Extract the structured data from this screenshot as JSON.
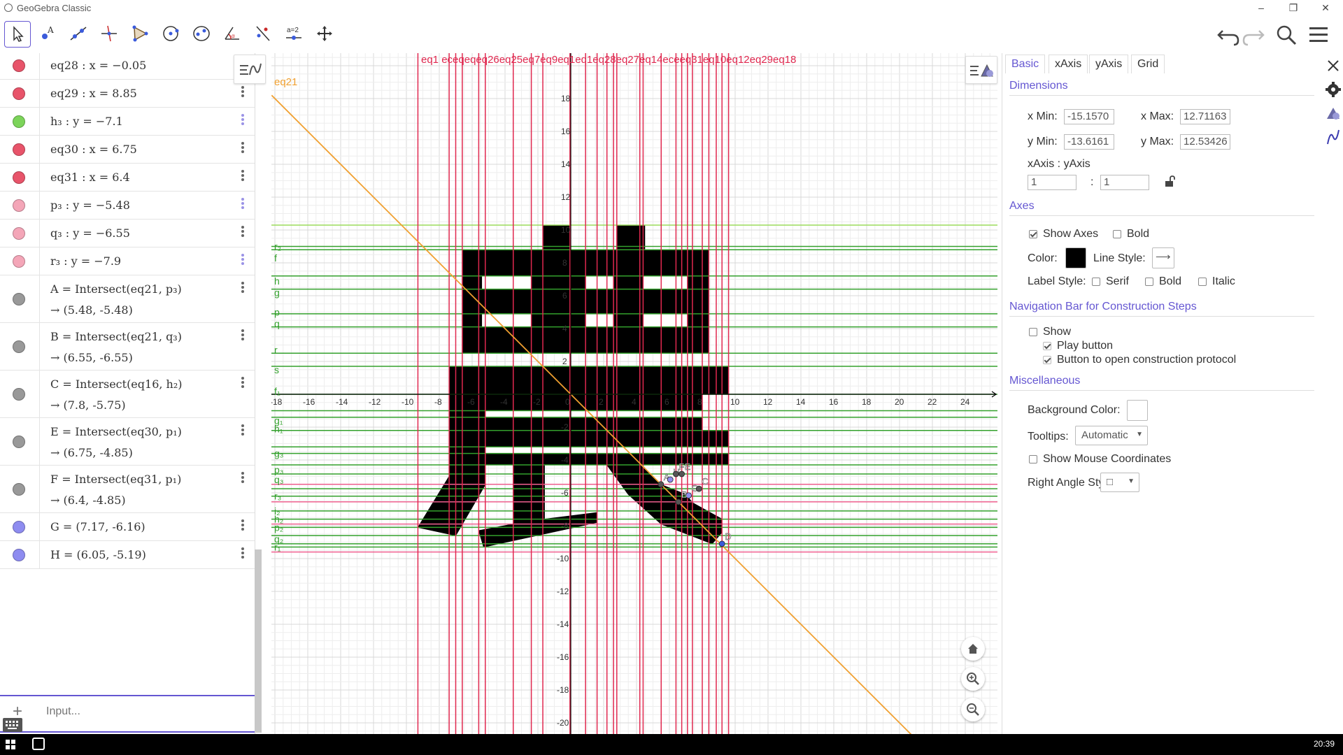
{
  "window": {
    "title": "GeoGebra Classic",
    "minimize_icon": "minimize-icon",
    "restore_icon": "restore-icon",
    "close_icon": "close-icon"
  },
  "toolbar": {
    "tools": [
      {
        "name": "move-tool",
        "icon": "pointer-arrow-icon",
        "selected": true
      },
      {
        "name": "point-tool",
        "icon": "point-icon",
        "label": "A"
      },
      {
        "name": "line-tool",
        "icon": "line-through-points-icon"
      },
      {
        "name": "perpendicular-line-tool",
        "icon": "perpendicular-icon"
      },
      {
        "name": "polygon-tool",
        "icon": "polygon-icon"
      },
      {
        "name": "circle-tool",
        "icon": "circle-center-point-icon"
      },
      {
        "name": "ellipse-tool",
        "icon": "ellipse-icon"
      },
      {
        "name": "angle-tool",
        "icon": "angle-icon",
        "label": "α"
      },
      {
        "name": "reflect-tool",
        "icon": "reflect-line-icon"
      },
      {
        "name": "slider-tool",
        "icon": "slider-icon",
        "label": "a=2"
      },
      {
        "name": "move-view-tool",
        "icon": "move-graphics-view-icon"
      }
    ],
    "right": [
      "undo-icon",
      "redo-icon",
      "search-icon",
      "menu-icon"
    ]
  },
  "algebra": {
    "style_button_icon": "algebra-style-icon",
    "rows": [
      {
        "color": "#e8546a",
        "def": "eq28 :  x = −0.05",
        "menu": "dark"
      },
      {
        "color": "#e8546a",
        "def": "eq29 :  x = 8.85",
        "menu": "dark"
      },
      {
        "color": "#7cd45a",
        "def": "h₃ :  y = −7.1",
        "menu": "light"
      },
      {
        "color": "#e8546a",
        "def": "eq30 :  x = 6.75",
        "menu": "dark"
      },
      {
        "color": "#e8546a",
        "def": "eq31 :  x = 6.4",
        "menu": "dark"
      },
      {
        "color": "#f4a6b8",
        "def": "p₃ :  y = −5.48",
        "menu": "light"
      },
      {
        "color": "#f4a6b8",
        "def": "q₃ :  y = −6.55",
        "menu": "dark"
      },
      {
        "color": "#f4a6b8",
        "def": "r₃ :  y = −7.9",
        "menu": "light"
      },
      {
        "color": "#999999",
        "def": "A = Intersect(eq21, p₃)",
        "val": "→  (5.48, -5.48)",
        "menu": "dark"
      },
      {
        "color": "#999999",
        "def": "B = Intersect(eq21, q₃)",
        "val": "→  (6.55, -6.55)",
        "menu": "dark"
      },
      {
        "color": "#999999",
        "def": "C = Intersect(eq16, h₂)",
        "val": "→  (7.8, -5.75)",
        "menu": "dark"
      },
      {
        "color": "#999999",
        "def": "E = Intersect(eq30, p₁)",
        "val": "→  (6.75, -4.85)",
        "menu": "dark"
      },
      {
        "color": "#999999",
        "def": "F = Intersect(eq31, p₁)",
        "val": "→  (6.4, -4.85)",
        "menu": "dark"
      },
      {
        "color": "#8e8cf0",
        "def": "G = (7.17, -6.16)",
        "menu": "dark"
      },
      {
        "color": "#8e8cf0",
        "def": "H = (6.05, -5.19)",
        "menu": "dark"
      }
    ],
    "input_placeholder": "Input..."
  },
  "graphics": {
    "x_ticks": [
      "-18",
      "-16",
      "-14",
      "-12",
      "-10",
      "-8",
      "-6",
      "-4",
      "-2",
      "0",
      "2",
      "4",
      "6",
      "8",
      "10",
      "12",
      "14",
      "16",
      "18",
      "20",
      "22",
      "24"
    ],
    "y_ticks": [
      "18",
      "16",
      "14",
      "12",
      "10",
      "8",
      "6",
      "4",
      "2",
      "-2",
      "-4",
      "-6",
      "-8",
      "-10",
      "-12",
      "-14",
      "-16",
      "-18",
      "-20"
    ],
    "line_label_top": "eq1  eceqeqeq26eq25eq7eq9eq1eq1eq28eq27eq14eceeq31eq10eq12eq29eq18",
    "diag_label": "eq21",
    "left_labels": [
      "r₂",
      "f",
      "h",
      "g",
      "p",
      "q",
      "r",
      "s",
      "f₁",
      "g₁",
      "h₁",
      "g₃",
      "p₃",
      "q₃",
      "r₃",
      "i₂",
      "h₂",
      "p₂",
      "q₂",
      "r₁"
    ],
    "point_labels": [
      "A",
      "H",
      "F",
      "E",
      "G",
      "C",
      "B",
      "D"
    ],
    "colors": {
      "red_lines": "#e0284f",
      "green_lines": "#33a02c",
      "light_green": "#9bdc5c",
      "pink": "#f06090",
      "diag": "#f0a030",
      "shape": "#000000",
      "grid_major": "#d8d8d8",
      "grid_minor": "#eeeeee"
    },
    "buttons": [
      "graphics-style-icon",
      "home-icon",
      "zoom-in-icon",
      "zoom-out-icon"
    ]
  },
  "props": {
    "tabs": [
      "Basic",
      "xAxis",
      "yAxis",
      "Grid"
    ],
    "active_tab": "Basic",
    "close_icon": "close-icon",
    "dimensions": {
      "title": "Dimensions",
      "xmin_label": "x Min:",
      "xmin": "-15.1570",
      "xmax_label": "x Max:",
      "xmax": "12.71163",
      "ymin_label": "y Min:",
      "ymin": "-13.6161",
      "ymax_label": "y Max:",
      "ymax": "12.53426",
      "ratio_label": "xAxis : yAxis",
      "ratio_x": "1",
      "ratio_sep": ":",
      "ratio_y": "1",
      "lock_icon": "unlock-icon"
    },
    "axes": {
      "title": "Axes",
      "show_axes": "Show Axes",
      "bold": "Bold",
      "color_label": "Color:",
      "color": "#000000",
      "line_style_label": "Line Style:",
      "line_style_value": "⟶",
      "label_style_label": "Label Style:",
      "serif": "Serif",
      "bold2": "Bold",
      "italic": "Italic"
    },
    "nav": {
      "title": "Navigation Bar for Construction Steps",
      "show": "Show",
      "play": "Play button",
      "protocol": "Button to open construction protocol"
    },
    "misc": {
      "title": "Miscellaneous",
      "bg_label": "Background Color:",
      "tooltips_label": "Tooltips:",
      "tooltips_value": "Automatic",
      "mouse_coords": "Show Mouse Coordinates",
      "right_angle_label": "Right Angle Style:",
      "right_angle_value": "□"
    },
    "side_icons": [
      "settings-gear-icon",
      "graphics-view-icon",
      "algebra-function-icon"
    ]
  },
  "taskbar": {
    "clock": "20:39",
    "start_icon": "windows-start-icon",
    "app_icon": "geogebra-taskbar-icon"
  }
}
